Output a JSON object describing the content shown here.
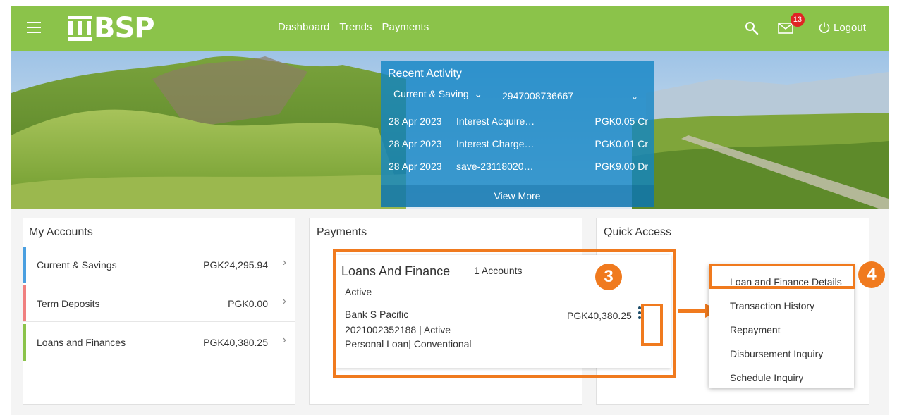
{
  "header": {
    "menu_icon": "hamburger-icon",
    "logo_text": "BSP",
    "nav": [
      "Dashboard",
      "Trends",
      "Payments"
    ],
    "search_icon": "search-icon",
    "mail_icon": "mail-icon",
    "mail_badge": "13",
    "logout_icon": "power-icon",
    "logout_label": "Logout",
    "colors": {
      "header_bg": "#8bc34a",
      "badge": "#e02424"
    }
  },
  "recent_activity": {
    "title": "Recent Activity",
    "account_type": "Current & Saving",
    "account_number": "2947008736667",
    "rows": [
      {
        "date": "28 Apr 2023",
        "description": "Interest Acquire…",
        "amount": "PGK0.05 Cr"
      },
      {
        "date": "28 Apr 2023",
        "description": "Interest Charge…",
        "amount": "PGK0.01 Cr"
      },
      {
        "date": "28 Apr 2023",
        "description": "save-23118020…",
        "amount": "PGK9.00 Dr"
      }
    ],
    "view_more": "View More"
  },
  "my_accounts": {
    "title": "My Accounts",
    "items": [
      {
        "label": "Current & Savings",
        "value": "PGK24,295.94",
        "color": "#4a9fe0"
      },
      {
        "label": "Term Deposits",
        "value": "PGK0.00",
        "color": "#f08080"
      },
      {
        "label": "Loans and Finances",
        "value": "PGK40,380.25",
        "color": "#8bc34a"
      }
    ]
  },
  "payments": {
    "title": "Payments",
    "loan_card": {
      "title": "Loans And Finance",
      "count": "1 Accounts",
      "status": "Active",
      "bank": "Bank S Pacific",
      "account": "2021002352188 | Active",
      "type": "Personal Loan| Conventional",
      "amount": "PGK40,380.25"
    }
  },
  "quick_access": {
    "title": "Quick Access",
    "menu": [
      "Loan and Finance Details",
      "Transaction History",
      "Repayment",
      "Disbursement Inquiry",
      "Schedule Inquiry"
    ]
  },
  "annotations": {
    "step_a": "3",
    "step_b": "4",
    "color": "#f07a1e"
  }
}
